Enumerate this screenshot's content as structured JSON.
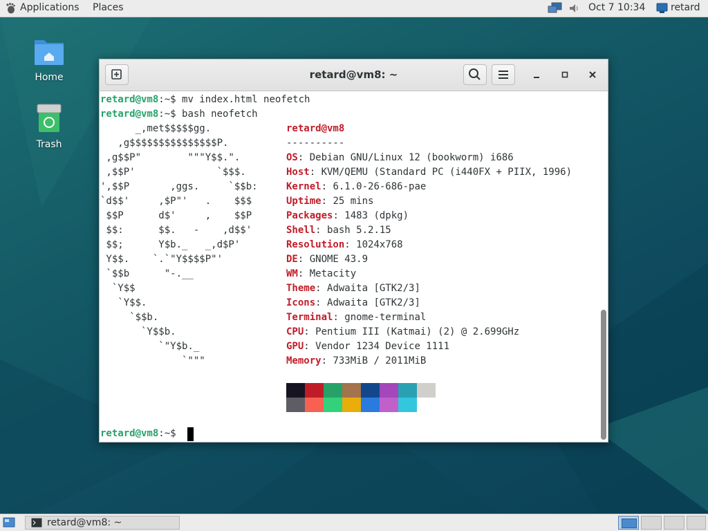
{
  "top_panel": {
    "applications": "Applications",
    "places": "Places",
    "datetime": "Oct 7  10:34",
    "user": "retard"
  },
  "desktop": {
    "icons": [
      {
        "label": "Home",
        "icon": "folder-home-icon"
      },
      {
        "label": "Trash",
        "icon": "trash-icon"
      }
    ]
  },
  "terminal": {
    "title": "retard@vm8: ~",
    "prompt_user": "retard@vm8",
    "prompt_path": ":~$ ",
    "commands": [
      "mv index.html neofetch",
      "bash neofetch"
    ],
    "ascii_art": [
      "      _,met$$$$$gg.",
      "   ,g$$$$$$$$$$$$$$$P.",
      " ,g$$P\"        \"\"\"Y$$.\".",
      " ,$$P'              `$$$.",
      "',$$P       ,ggs.     `$$b:",
      "`d$$'     ,$P\"'   .    $$$",
      " $$P      d$'     ,    $$P",
      " $$:      $$.   -    ,d$$'",
      " $$;      Y$b._   _,d$P'",
      " Y$$.    `.`\"Y$$$$P\"'",
      " `$$b      \"-.__",
      "  `Y$$",
      "   `Y$$.",
      "     `$$b.",
      "       `Y$$b.",
      "          `\"Y$b._",
      "              `\"\"\""
    ],
    "info_header": "retard@vm8",
    "separator": "----------",
    "info": [
      {
        "key": "OS",
        "value": "Debian GNU/Linux 12 (bookworm) i686"
      },
      {
        "key": "Host",
        "value": "KVM/QEMU (Standard PC (i440FX + PIIX, 1996)"
      },
      {
        "key": "Kernel",
        "value": "6.1.0-26-686-pae"
      },
      {
        "key": "Uptime",
        "value": "25 mins"
      },
      {
        "key": "Packages",
        "value": "1483 (dpkg)"
      },
      {
        "key": "Shell",
        "value": "bash 5.2.15"
      },
      {
        "key": "Resolution",
        "value": "1024x768"
      },
      {
        "key": "DE",
        "value": "GNOME 43.9"
      },
      {
        "key": "WM",
        "value": "Metacity"
      },
      {
        "key": "Theme",
        "value": "Adwaita [GTK2/3]"
      },
      {
        "key": "Icons",
        "value": "Adwaita [GTK2/3]"
      },
      {
        "key": "Terminal",
        "value": "gnome-terminal"
      },
      {
        "key": "CPU",
        "value": "Pentium III (Katmai) (2) @ 2.699GHz"
      },
      {
        "key": "GPU",
        "value": "Vendor 1234 Device 1111"
      },
      {
        "key": "Memory",
        "value": "733MiB / 2011MiB"
      }
    ],
    "palette_row1": [
      "#171421",
      "#c01c28",
      "#26a269",
      "#a2734c",
      "#12488b",
      "#a347ba",
      "#2aa1b3",
      "#d0cfcc"
    ],
    "palette_row2": [
      "#5e5c64",
      "#f66151",
      "#33d17a",
      "#e9ad0c",
      "#2a7bde",
      "#c061cb",
      "#33c7de",
      "#ffffff"
    ]
  },
  "taskbar": {
    "task_label": "retard@vm8: ~"
  }
}
